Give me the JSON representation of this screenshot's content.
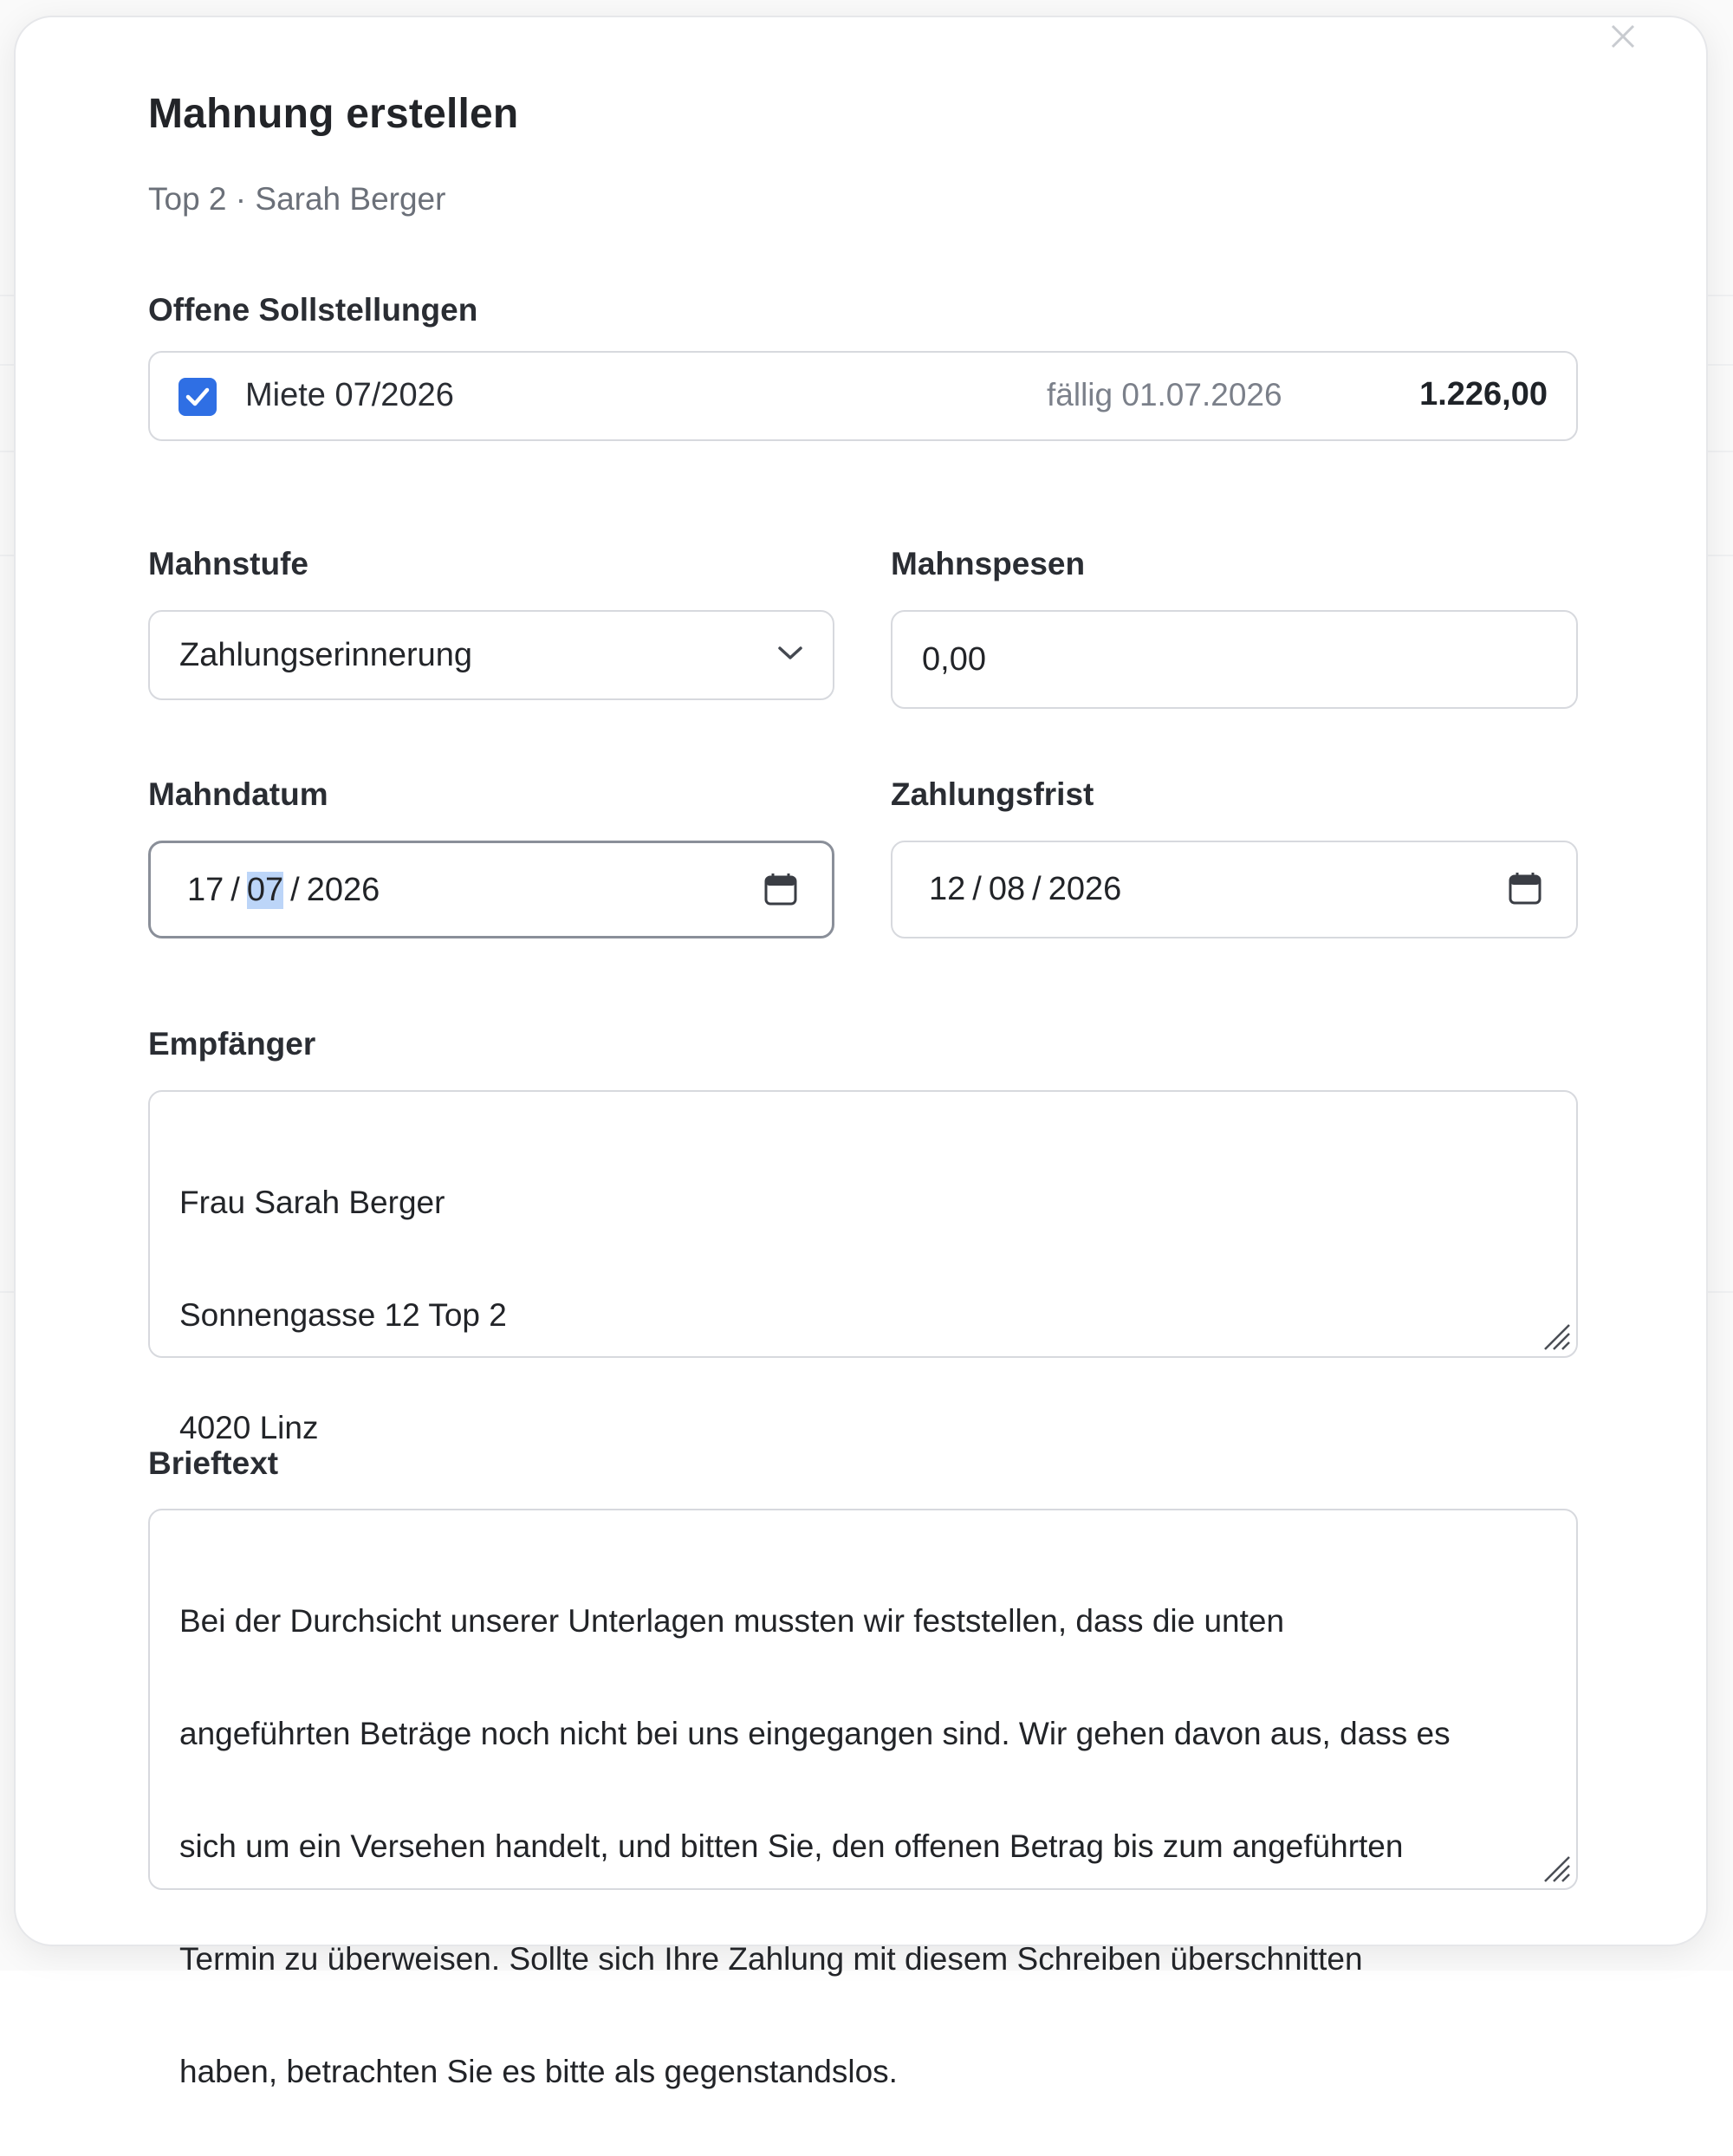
{
  "modal": {
    "title": "Mahnung erstellen",
    "subtitle": "Top 2 · Sarah Berger"
  },
  "open_items": {
    "label": "Offene Sollstellungen",
    "items": [
      {
        "checked": true,
        "name": "Miete 07/2026",
        "due": "fällig 01.07.2026",
        "amount": "1.226,00"
      }
    ]
  },
  "mahnstufe": {
    "label": "Mahnstufe",
    "value": "Zahlungserinnerung"
  },
  "mahnspesen": {
    "label": "Mahnspesen",
    "value": "0,00"
  },
  "mahndatum": {
    "label": "Mahndatum",
    "day": "17",
    "month": "07",
    "year": "2026",
    "separator": "/"
  },
  "zahlungsfrist": {
    "label": "Zahlungsfrist",
    "day": "12",
    "month": "08",
    "year": "2026",
    "separator": "/"
  },
  "empfaenger": {
    "label": "Empfänger",
    "lines": [
      "Frau Sarah Berger",
      "Sonnengasse 12 Top 2",
      "4020 Linz"
    ]
  },
  "brieftext": {
    "label": "Brieftext",
    "lines": [
      "Bei der Durchsicht unserer Unterlagen mussten wir feststellen, dass die unten",
      "angeführten Beträge noch nicht bei uns eingegangen sind. Wir gehen davon aus, dass es",
      "sich um ein Versehen handelt, und bitten Sie, den offenen Betrag bis zum angeführten",
      "Termin zu überweisen. Sollte sich Ihre Zahlung mit diesem Schreiben überschnitten",
      "haben, betrachten Sie es bitte als gegenstandslos."
    ]
  },
  "colors": {
    "accent": "#2f6fe4",
    "selection": "#bcd5f8",
    "border": "#d7d9de",
    "muted_text": "#6b7079"
  },
  "icons": {
    "close": "close-icon",
    "checkbox": "checkmark-icon",
    "dropdown": "chevron-down-icon",
    "date": "calendar-icon",
    "resize": "resize-handle-icon"
  }
}
